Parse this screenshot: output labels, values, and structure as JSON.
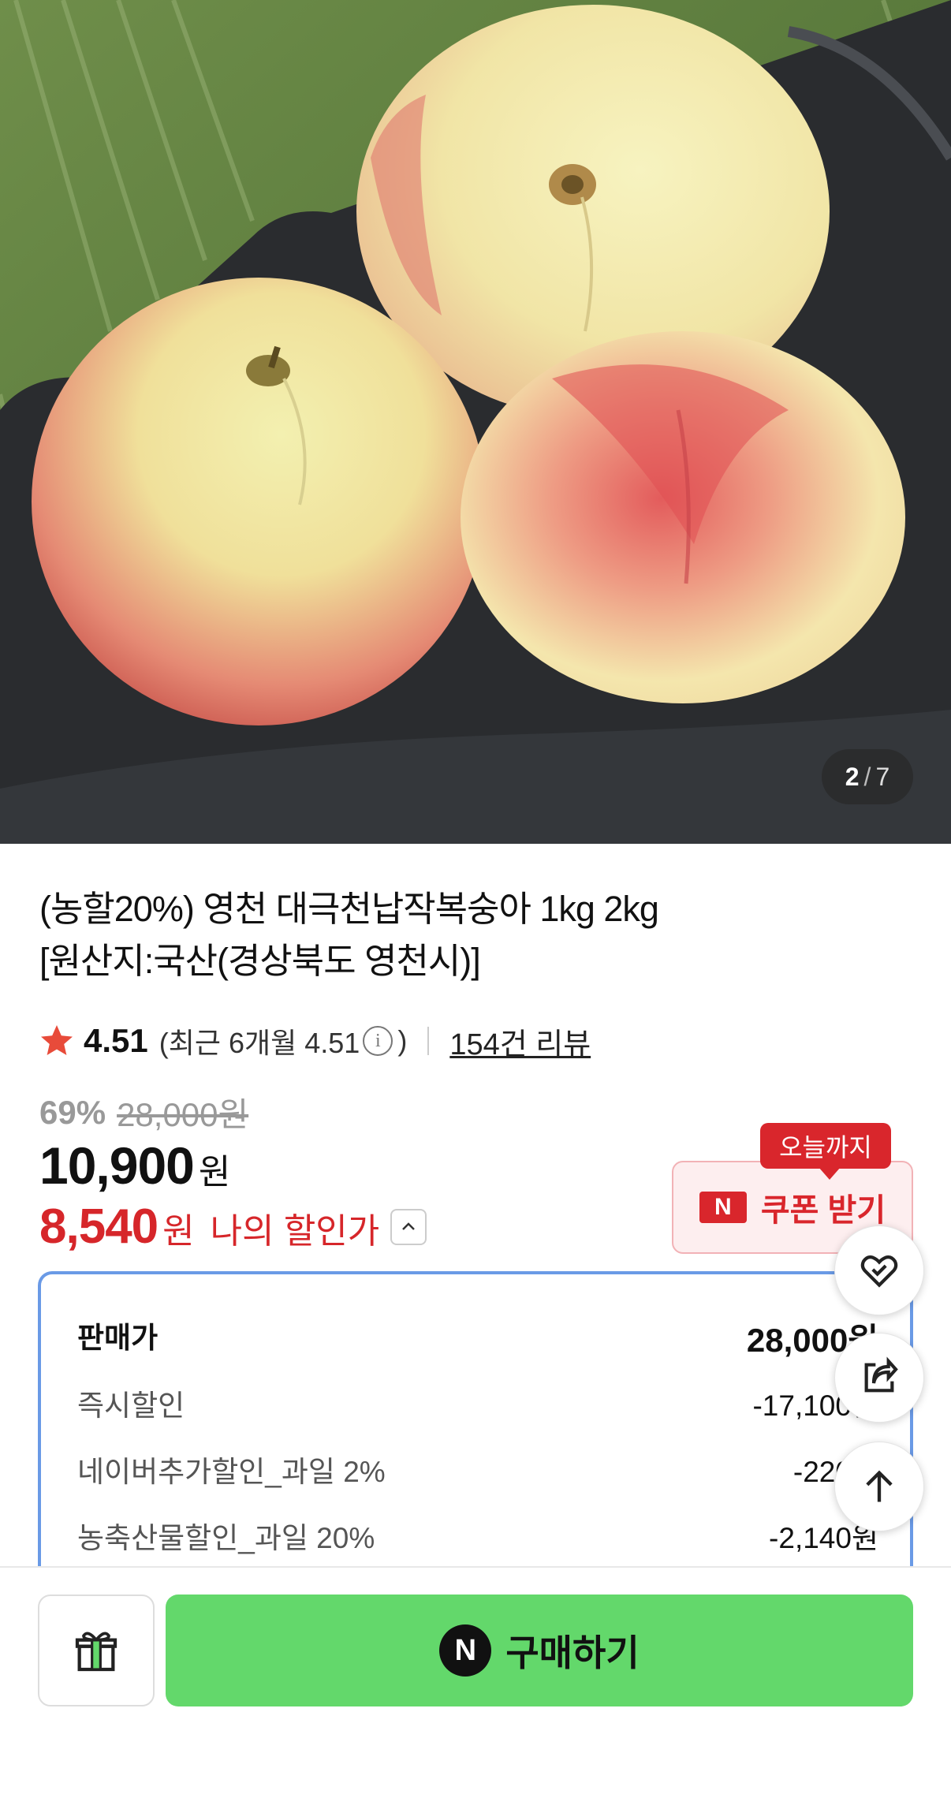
{
  "gallery": {
    "current": "2",
    "separator": "/",
    "total": "7",
    "image_icon": "peach-photo"
  },
  "product": {
    "title_line1": "(농할20%) 영천 대극천납작복숭아 1kg 2kg",
    "title_line2": "[원산지:국산(경상북도 영천시)]"
  },
  "rating": {
    "score": "4.51",
    "recent_prefix": "(최근 6개월 4.51",
    "recent_suffix": ")",
    "info_icon": "i",
    "reviews": "154건 리뷰",
    "star_color": "#e84b3a"
  },
  "price": {
    "discount_pct": "69%",
    "original": "28,000원",
    "sale": "10,900",
    "sale_unit": "원",
    "my_price": "8,540",
    "my_price_unit": "원",
    "my_price_label": "나의 할인가"
  },
  "coupon": {
    "tag": "오늘까지",
    "logo": "N",
    "label": "쿠폰 받기",
    "accent": "#d9262c"
  },
  "breakdown": {
    "rows": [
      {
        "label": "판매가",
        "value": "28,000원"
      },
      {
        "label": "즉시할인",
        "value": "-17,100원"
      },
      {
        "label": "네이버추가할인_과일 2%",
        "value": "-220원"
      },
      {
        "label": "농축산물할인_과일 20%",
        "value": "-2,140원"
      }
    ],
    "border_color": "#6a9ae6"
  },
  "floating": {
    "like_icon": "heart-check-icon",
    "share_icon": "share-icon",
    "top_icon": "arrow-up-icon"
  },
  "bottom": {
    "gift_icon": "gift-icon",
    "buy_logo": "N",
    "buy_label": "구매하기",
    "buy_color": "#63d86b"
  }
}
